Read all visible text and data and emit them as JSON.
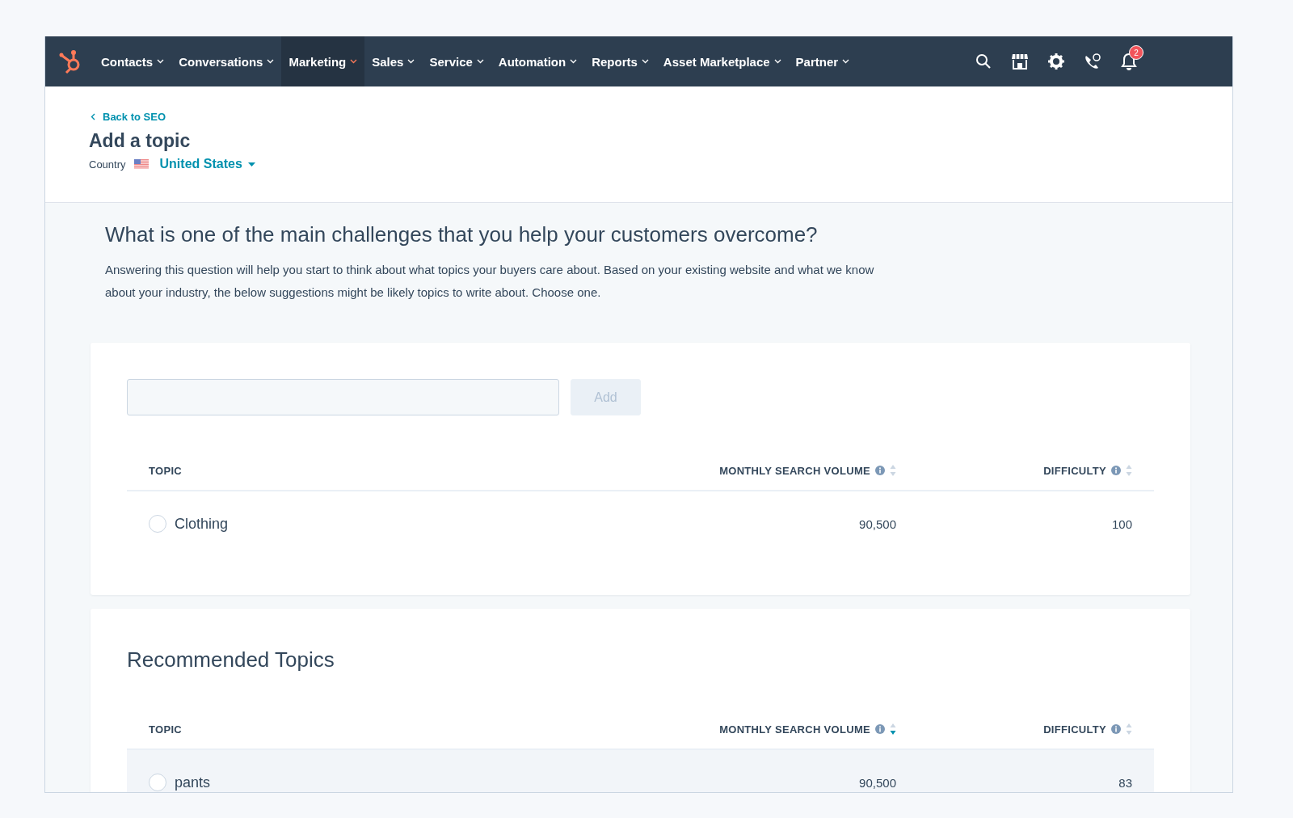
{
  "nav": {
    "items": [
      {
        "label": "Contacts",
        "selected": false
      },
      {
        "label": "Conversations",
        "selected": false
      },
      {
        "label": "Marketing",
        "selected": true
      },
      {
        "label": "Sales",
        "selected": false
      },
      {
        "label": "Service",
        "selected": false
      },
      {
        "label": "Automation",
        "selected": false
      },
      {
        "label": "Reports",
        "selected": false
      },
      {
        "label": "Asset Marketplace",
        "selected": false
      },
      {
        "label": "Partner",
        "selected": false
      }
    ],
    "notification_count": "2"
  },
  "header": {
    "back_link": "Back to SEO",
    "title": "Add a topic",
    "country_label": "Country",
    "country": "United States"
  },
  "question": {
    "title": "What is one of the main challenges that you help your customers overcome?",
    "description": "Answering this question will help you start to think about what topics your buyers care about. Based on your existing website and what we know about your industry, the below suggestions might be likely topics to write about. Choose one."
  },
  "add_topic": {
    "button": "Add",
    "disabled": true
  },
  "topics_table": {
    "columns": [
      {
        "label": "TOPIC",
        "kind": "text"
      },
      {
        "label": "MONTHLY SEARCH VOLUME",
        "kind": "metric",
        "sorted": false
      },
      {
        "label": "DIFFICULTY",
        "kind": "metric",
        "sorted": false
      }
    ],
    "rows": [
      {
        "topic": "Clothing",
        "volume": "90,500",
        "difficulty": "100",
        "selected": false,
        "highlighted": false
      }
    ]
  },
  "recommended": {
    "title": "Recommended Topics",
    "columns": [
      {
        "label": "TOPIC",
        "kind": "text"
      },
      {
        "label": "MONTHLY SEARCH VOLUME",
        "kind": "metric",
        "sorted": true
      },
      {
        "label": "DIFFICULTY",
        "kind": "metric",
        "sorted": false
      }
    ],
    "rows": [
      {
        "topic": "pants",
        "volume": "90,500",
        "difficulty": "83",
        "selected": false,
        "highlighted": true
      }
    ]
  }
}
